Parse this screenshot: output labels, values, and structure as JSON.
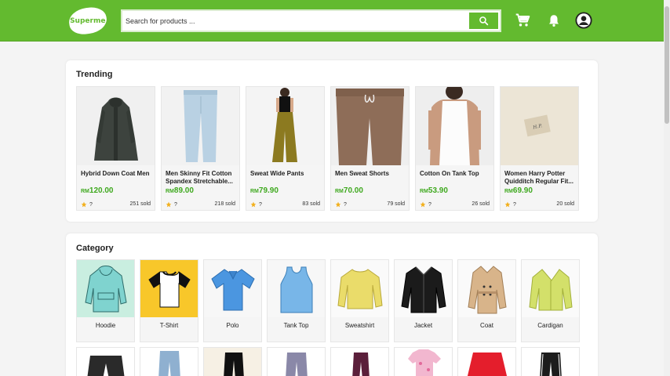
{
  "header": {
    "logo_text": "Superme",
    "search_placeholder": "Search for products ...",
    "icons": [
      "search-icon",
      "cart-icon",
      "bell-icon",
      "account-icon"
    ],
    "brand_color": "#63ba2f"
  },
  "trending": {
    "title": "Trending",
    "products": [
      {
        "name": "Hybrid Down Coat Men",
        "currency": "RM",
        "price": "120.00",
        "rating": "?",
        "sold": "251 sold"
      },
      {
        "name": "Men Skinny Fit Cotton Spandex Stretchable...",
        "currency": "RM",
        "price": "89.00",
        "rating": "?",
        "sold": "218 sold"
      },
      {
        "name": "Sweat Wide Pants",
        "currency": "RM",
        "price": "79.90",
        "rating": "?",
        "sold": "83 sold"
      },
      {
        "name": "Men Sweat Shorts",
        "currency": "RM",
        "price": "70.00",
        "rating": "?",
        "sold": "79 sold"
      },
      {
        "name": "Cotton On Tank Top",
        "currency": "RM",
        "price": "53.90",
        "rating": "?",
        "sold": "26 sold"
      },
      {
        "name": "Women Harry Potter Quidditch Regular Fit...",
        "currency": "RM",
        "price": "69.90",
        "rating": "?",
        "sold": "20 sold"
      }
    ],
    "accent_price_color": "#3fa91f",
    "star_color": "#f2b01e"
  },
  "category": {
    "title": "Category",
    "items": [
      {
        "label": "Hoodie"
      },
      {
        "label": "T-Shirt"
      },
      {
        "label": "Polo"
      },
      {
        "label": "Tank Top"
      },
      {
        "label": "Sweatshirt"
      },
      {
        "label": "Jacket"
      },
      {
        "label": "Coat"
      },
      {
        "label": "Cardigan"
      }
    ]
  }
}
